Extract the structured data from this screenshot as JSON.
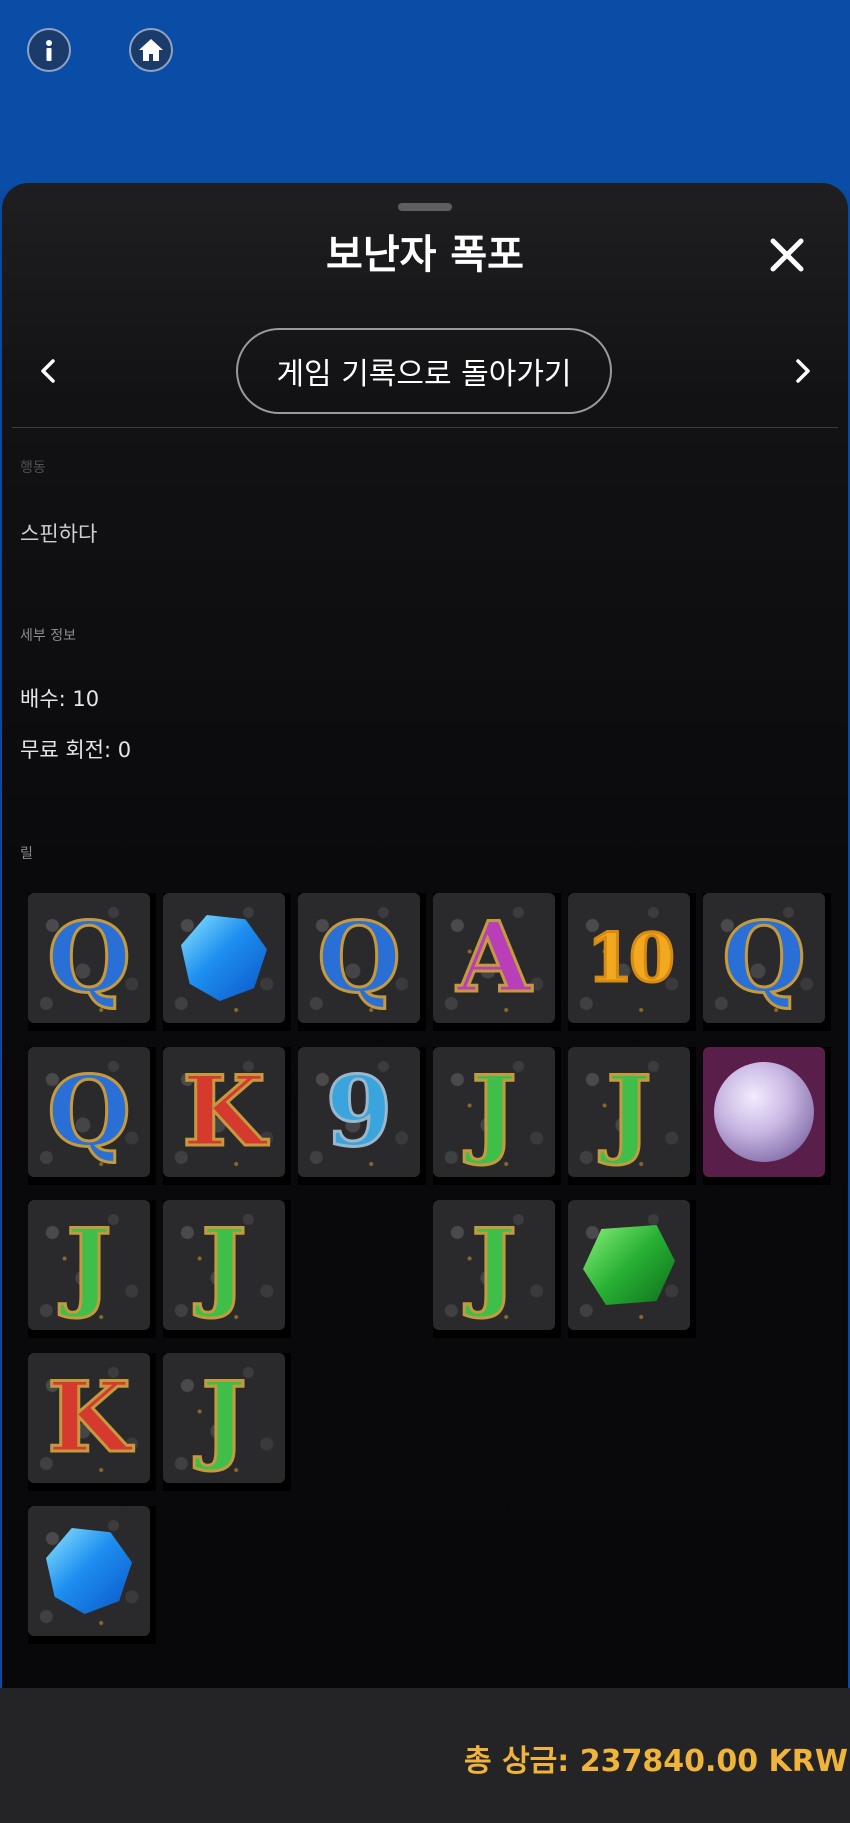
{
  "header": {
    "info_icon": "info-icon",
    "home_icon": "home-icon"
  },
  "sheet": {
    "title": "보난자 폭포",
    "back_button_label": "게임 기록으로 돌아가기"
  },
  "action": {
    "label": "행동",
    "value": "스핀하다"
  },
  "details": {
    "label": "세부 정보",
    "multiplier": "배수: 10",
    "free_spins": "무료 회전: 0"
  },
  "reels": {
    "label": "릴",
    "columns": [
      [
        "Q",
        "Q",
        "J",
        "K",
        "blue-gem"
      ],
      [
        "blue-gem",
        "K",
        "J",
        "J"
      ],
      [
        "Q",
        "9"
      ],
      [
        "A",
        "J",
        "J"
      ],
      [
        "10",
        "J",
        "green-gem"
      ],
      [
        "Q",
        "diamond"
      ]
    ]
  },
  "footer": {
    "total_win": "총 상금: 237840.00 KRW"
  },
  "colors": {
    "top_bar": "#0a4da6",
    "accent_gold": "#f0b43a"
  }
}
